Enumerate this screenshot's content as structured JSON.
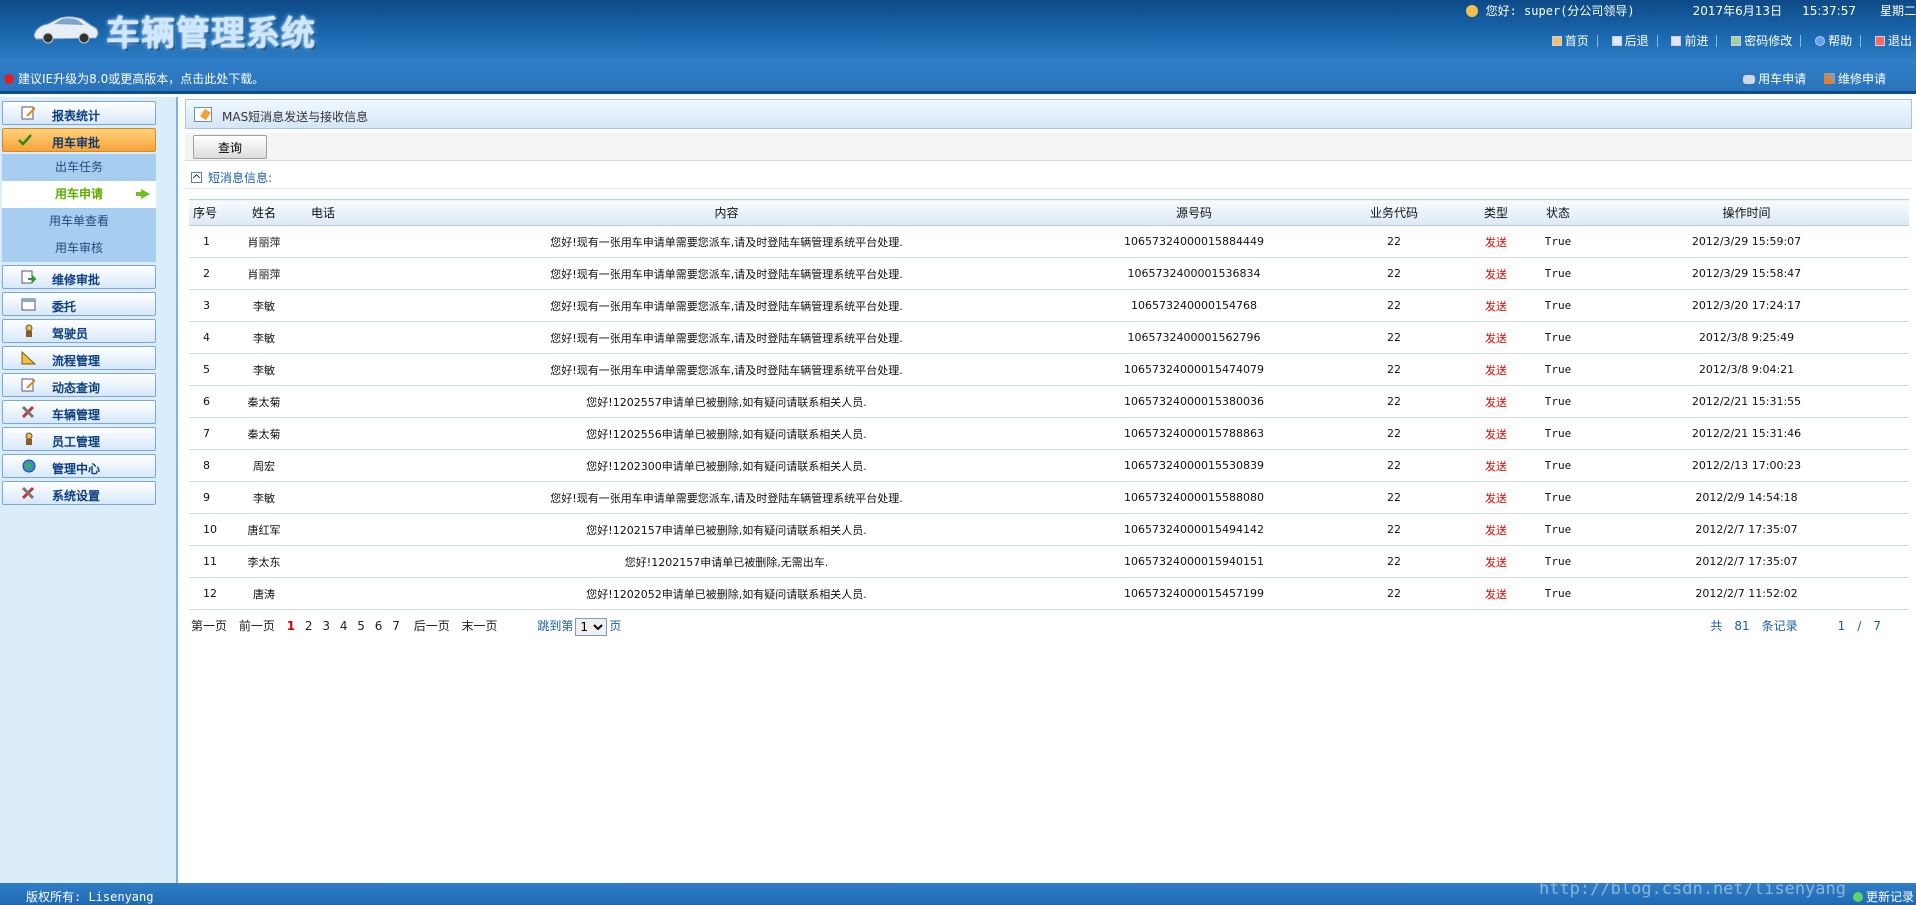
{
  "header": {
    "title": "车辆管理系统",
    "greeting": "您好: super(分公司领导)",
    "date": "2017年6月13日",
    "time": "15:37:57",
    "weekday": "星期二",
    "nav": {
      "home": "首页",
      "back": "后退",
      "forward": "前进",
      "password": "密码修改",
      "help": "帮助",
      "logout": "退出"
    }
  },
  "subbar": {
    "ie_warning": "建议IE升级为8.0或更高版本，点击此处下载。",
    "quick_vehicle_request": "用车申请",
    "quick_repair_request": "维修申请"
  },
  "sidebar": {
    "groups": [
      {
        "label": "报表统计"
      },
      {
        "label": "用车审批"
      },
      {
        "label": "维修审批"
      },
      {
        "label": "委托"
      },
      {
        "label": "驾驶员"
      },
      {
        "label": "流程管理"
      },
      {
        "label": "动态查询"
      },
      {
        "label": "车辆管理"
      },
      {
        "label": "员工管理"
      },
      {
        "label": "管理中心"
      },
      {
        "label": "系统设置"
      }
    ],
    "subitems": [
      {
        "label": "出车任务"
      },
      {
        "label": "用车申请"
      },
      {
        "label": "用车单查看"
      },
      {
        "label": "用车审核"
      }
    ]
  },
  "panel": {
    "title": "MAS短消息发送与接收信息",
    "query_button": "查询",
    "section_label": "短消息信息:"
  },
  "table": {
    "headers": [
      "序号",
      "姓名",
      "电话",
      "内容",
      "源号码",
      "业务代码",
      "类型",
      "状态",
      "操作时间"
    ],
    "rows": [
      {
        "seq": "1",
        "name": "肖丽萍",
        "phone": "",
        "content": "您好!现有一张用车申请单需要您派车,请及时登陆车辆管理系统平台处理.",
        "source": "10657324000015884449",
        "code": "22",
        "type": "发送",
        "status": "True",
        "time": "2012/3/29 15:59:07"
      },
      {
        "seq": "2",
        "name": "肖丽萍",
        "phone": "",
        "content": "您好!现有一张用车申请单需要您派车,请及时登陆车辆管理系统平台处理.",
        "source": "1065732400001536834",
        "code": "22",
        "type": "发送",
        "status": "True",
        "time": "2012/3/29 15:58:47"
      },
      {
        "seq": "3",
        "name": "李敏",
        "phone": "",
        "content": "您好!现有一张用车申请单需要您派车,请及时登陆车辆管理系统平台处理.",
        "source": "106573240000154768",
        "code": "22",
        "type": "发送",
        "status": "True",
        "time": "2012/3/20 17:24:17"
      },
      {
        "seq": "4",
        "name": "李敏",
        "phone": "",
        "content": "您好!现有一张用车申请单需要您派车,请及时登陆车辆管理系统平台处理.",
        "source": "1065732400001562796",
        "code": "22",
        "type": "发送",
        "status": "True",
        "time": "2012/3/8 9:25:49"
      },
      {
        "seq": "5",
        "name": "李敏",
        "phone": "",
        "content": "您好!现有一张用车申请单需要您派车,请及时登陆车辆管理系统平台处理.",
        "source": "10657324000015474079",
        "code": "22",
        "type": "发送",
        "status": "True",
        "time": "2012/3/8 9:04:21"
      },
      {
        "seq": "6",
        "name": "秦太菊",
        "phone": "",
        "content": "您好!1202557申请单已被删除,如有疑问请联系相关人员.",
        "source": "10657324000015380036",
        "code": "22",
        "type": "发送",
        "status": "True",
        "time": "2012/2/21 15:31:55"
      },
      {
        "seq": "7",
        "name": "秦太菊",
        "phone": "",
        "content": "您好!1202556申请单已被删除,如有疑问请联系相关人员.",
        "source": "10657324000015788863",
        "code": "22",
        "type": "发送",
        "status": "True",
        "time": "2012/2/21 15:31:46"
      },
      {
        "seq": "8",
        "name": "周宏",
        "phone": "",
        "content": "您好!1202300申请单已被删除,如有疑问请联系相关人员.",
        "source": "10657324000015530839",
        "code": "22",
        "type": "发送",
        "status": "True",
        "time": "2012/2/13 17:00:23"
      },
      {
        "seq": "9",
        "name": "李敏",
        "phone": "",
        "content": "您好!现有一张用车申请单需要您派车,请及时登陆车辆管理系统平台处理.",
        "source": "10657324000015588080",
        "code": "22",
        "type": "发送",
        "status": "True",
        "time": "2012/2/9 14:54:18"
      },
      {
        "seq": "10",
        "name": "唐红军",
        "phone": "",
        "content": "您好!1202157申请单已被删除,如有疑问请联系相关人员.",
        "source": "10657324000015494142",
        "code": "22",
        "type": "发送",
        "status": "True",
        "time": "2012/2/7 17:35:07"
      },
      {
        "seq": "11",
        "name": "李太东",
        "phone": "",
        "content": "您好!1202157申请单已被删除,无需出车.",
        "source": "10657324000015940151",
        "code": "22",
        "type": "发送",
        "status": "True",
        "time": "2012/2/7 17:35:07"
      },
      {
        "seq": "12",
        "name": "唐涛",
        "phone": "",
        "content": "您好!1202052申请单已被删除,如有疑问请联系相关人员.",
        "source": "10657324000015457199",
        "code": "22",
        "type": "发送",
        "status": "True",
        "time": "2012/2/7 11:52:02"
      }
    ]
  },
  "pager": {
    "first": "第一页",
    "prev": "前一页",
    "pages": [
      "1",
      "2",
      "3",
      "4",
      "5",
      "6",
      "7"
    ],
    "current_page": "1",
    "next": "后一页",
    "last": "末一页",
    "jump_prefix": "跳到第",
    "jump_selected": "1",
    "jump_suffix": "页",
    "total_label": "共",
    "total_count": "81",
    "records_label": "条记录",
    "page_current": "1",
    "page_sep": "/",
    "page_total": "7"
  },
  "footer": {
    "copyright": "版权所有: Lisenyang",
    "watermark": "http://blog.csdn.net/lisenyang",
    "update_log": "更新记录"
  },
  "colors": {
    "header_blue": "#1a66ad",
    "accent_orange": "#f6a33a",
    "type_red": "#e00000",
    "current_green": "#5dae00"
  }
}
